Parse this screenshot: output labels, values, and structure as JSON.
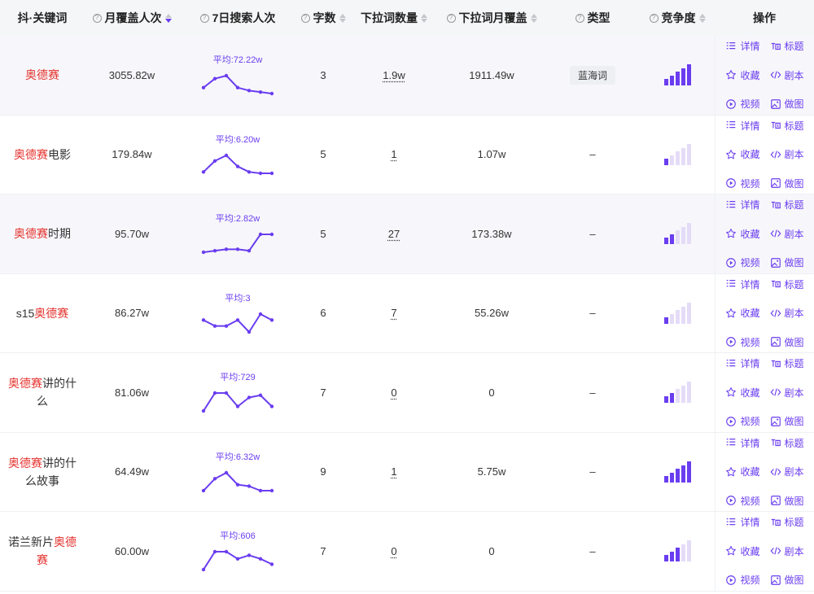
{
  "header": {
    "keyword": "抖·关键词",
    "monthly": "月覆盖人次",
    "trend": "7日搜索人次",
    "chars": "字数",
    "dropdown_count": "下拉词数量",
    "dropdown_coverage": "下拉词月覆盖",
    "type": "类型",
    "competition": "竞争度",
    "ops": "操作",
    "help_glyph": "?"
  },
  "ops_labels": {
    "detail": "详情",
    "title": "标题",
    "favorite": "收藏",
    "script": "剧本",
    "video": "视频",
    "image": "做图"
  },
  "colors": {
    "accent": "#6a3df0",
    "highlight": "#e5322d",
    "bar_off": "#e4dcf7"
  },
  "rows": [
    {
      "kw_pre": "",
      "kw_hl": "奥德赛",
      "kw_post": "",
      "monthly": "3055.82w",
      "avg": "平均:72.22w",
      "trend": [
        4,
        7,
        8,
        4,
        3,
        2.5,
        2
      ],
      "chars": "3",
      "dd_count": "1.9w",
      "dd_cov": "1911.49w",
      "type": "蓝海词",
      "comp_level": 5
    },
    {
      "kw_pre": "",
      "kw_hl": "奥德赛",
      "kw_post": "电影",
      "monthly": "179.84w",
      "avg": "平均:6.20w",
      "trend": [
        2,
        6,
        8,
        4,
        2,
        1.5,
        1.5
      ],
      "chars": "5",
      "dd_count": "1",
      "dd_cov": "1.07w",
      "type": "–",
      "comp_level": 1
    },
    {
      "kw_pre": "",
      "kw_hl": "奥德赛",
      "kw_post": "时期",
      "monthly": "95.70w",
      "avg": "平均:2.82w",
      "trend": [
        2,
        2.5,
        3,
        3,
        2.5,
        8,
        8
      ],
      "chars": "5",
      "dd_count": "27",
      "dd_cov": "173.38w",
      "type": "–",
      "comp_level": 2
    },
    {
      "kw_pre": "s15",
      "kw_hl": "奥德赛",
      "kw_post": "",
      "monthly": "86.27w",
      "avg": "平均:3",
      "trend": [
        3,
        2,
        2,
        3,
        1,
        4,
        3
      ],
      "chars": "6",
      "dd_count": "7",
      "dd_cov": "55.26w",
      "type": "–",
      "comp_level": 1
    },
    {
      "kw_pre": "",
      "kw_hl": "奥德赛",
      "kw_post": "讲的什么",
      "monthly": "81.06w",
      "avg": "平均:729",
      "trend": [
        2,
        6,
        6,
        3,
        5,
        5.5,
        3
      ],
      "chars": "7",
      "dd_count": "0",
      "dd_cov": "0",
      "type": "–",
      "comp_level": 2
    },
    {
      "kw_pre": "",
      "kw_hl": "奥德赛",
      "kw_post": "讲的什么故事",
      "monthly": "64.49w",
      "avg": "平均:6.32w",
      "trend": [
        1,
        5,
        7,
        3,
        2.5,
        1,
        1
      ],
      "chars": "9",
      "dd_count": "1",
      "dd_cov": "5.75w",
      "type": "–",
      "comp_level": 5
    },
    {
      "kw_pre": "诺兰新片",
      "kw_hl": "奥德赛",
      "kw_post": "",
      "monthly": "60.00w",
      "avg": "平均:606",
      "trend": [
        1,
        6,
        6,
        4,
        5,
        4,
        2.5
      ],
      "chars": "7",
      "dd_count": "0",
      "dd_cov": "0",
      "type": "–",
      "comp_level": 3
    }
  ]
}
